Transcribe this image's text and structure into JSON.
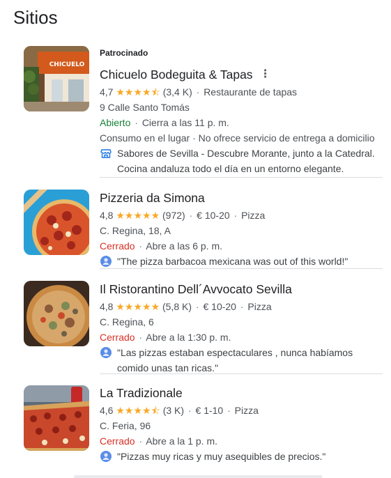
{
  "section_title": "Sitios",
  "places": [
    {
      "sponsored": "Patrocinado",
      "name": "Chicuelo Bodeguita & Tapas",
      "rating": "4,7",
      "stars": "★★★★⯪",
      "reviews": "(3,4 K)",
      "category": "Restaurante de tapas",
      "address": "9 Calle Santo Tomás",
      "status": "Abierto",
      "hours": "Cierra a las 11 p. m.",
      "services": "Consumo en el lugar · No ofrece servicio de entrega a domicilio",
      "snippet": "Sabores de Sevilla - Descubre Morante, junto a la Catedral. Cocina andaluza todo el día en un entorno elegante.",
      "snippet_icon": "storefront-icon",
      "thumb_sign": "CHICUELO"
    },
    {
      "name": "Pizzeria da Simona",
      "rating": "4,8",
      "stars": "★★★★★",
      "reviews": "(972)",
      "price": "€ 10-20",
      "category": "Pizza",
      "address": "C. Regina, 18, A",
      "status": "Cerrado",
      "hours": "Abre a las 6 p. m.",
      "snippet": "\"The pizza barbacoa mexicana was out of this world!\"",
      "snippet_icon": "user-avatar-icon"
    },
    {
      "name": "Il Ristorantino Dell´Avvocato Sevilla",
      "rating": "4,8",
      "stars": "★★★★★",
      "reviews": "(5,8 K)",
      "price": "€ 10-20",
      "category": "Pizza",
      "address": "C. Regina, 6",
      "status": "Cerrado",
      "hours": "Abre a la 1:30 p. m.",
      "snippet": "\"Las pizzas estaban espectaculares , nunca habíamos comido unas tan ricas.\"",
      "snippet_icon": "user-avatar-icon"
    },
    {
      "name": "La Tradizionale",
      "rating": "4,6",
      "stars": "★★★★⯪",
      "reviews": "(3 K)",
      "price": "€ 1-10",
      "category": "Pizza",
      "address": "C. Feria, 96",
      "status": "Cerrado",
      "hours": "Abre a la 1 p. m.",
      "snippet": "\"Pizzas muy ricas y muy asequibles de precios.\"",
      "snippet_icon": "user-avatar-icon"
    }
  ],
  "colors": {
    "open": "#188038",
    "closed": "#d93025",
    "stars": "#f9a825",
    "link_icon": "#1a73e8"
  },
  "more_options_icon": "more-vert-icon",
  "sep": "·"
}
